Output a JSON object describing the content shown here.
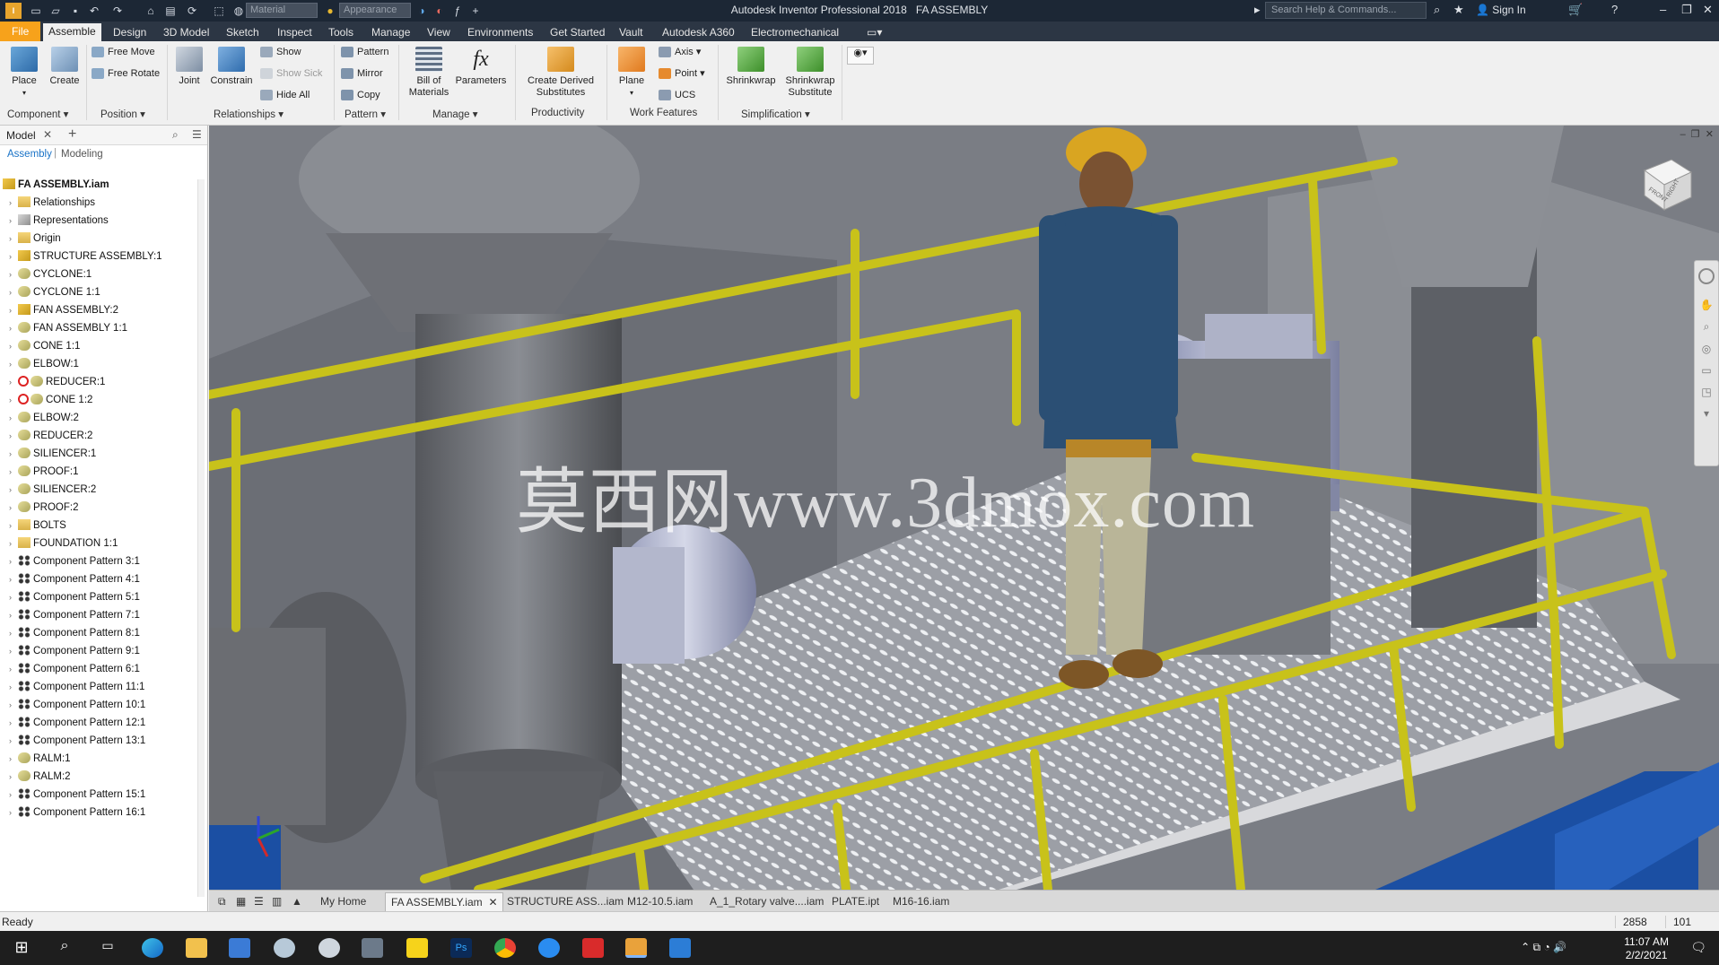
{
  "titlebar": {
    "app_title": "Autodesk Inventor Professional 2018",
    "doc_title": "FA ASSEMBLY",
    "material_dropdown": "Material",
    "appearance_dropdown": "Appearance",
    "search_placeholder": "Search Help & Commands...",
    "sign_in": "Sign In"
  },
  "menu": {
    "file": "File",
    "tabs": [
      "Assemble",
      "Design",
      "3D Model",
      "Sketch",
      "Inspect",
      "Tools",
      "Manage",
      "View",
      "Environments",
      "Get Started",
      "Vault",
      "Autodesk A360",
      "Electromechanical"
    ],
    "active_tab": "Assemble"
  },
  "ribbon": {
    "place": "Place",
    "create": "Create",
    "free_move": "Free Move",
    "free_rotate": "Free Rotate",
    "joint": "Joint",
    "constrain": "Constrain",
    "show": "Show",
    "show_sick": "Show Sick",
    "hide_all": "Hide All",
    "pattern": "Pattern",
    "mirror": "Mirror",
    "copy": "Copy",
    "bill_line1": "Bill of",
    "bill_line2": "Materials",
    "parameters": "Parameters",
    "derived_line1": "Create Derived",
    "derived_line2": "Substitutes",
    "plane": "Plane",
    "axis": "Axis",
    "point": "Point",
    "ucs": "UCS",
    "shrinkwrap": "Shrinkwrap",
    "shrink_sub_line1": "Shrinkwrap",
    "shrink_sub_line2": "Substitute",
    "panels": {
      "component": "Component",
      "position": "Position",
      "relationships": "Relationships",
      "pattern": "Pattern",
      "manage": "Manage",
      "productivity": "Productivity",
      "work_features": "Work Features",
      "simplification": "Simplification"
    }
  },
  "browser": {
    "tab_label": "Model",
    "sub_assembly": "Assembly",
    "sub_modeling": "Modeling",
    "root": "FA ASSEMBLY.iam",
    "nodes": [
      {
        "label": "Relationships",
        "icon": "folder"
      },
      {
        "label": "Representations",
        "icon": "rep"
      },
      {
        "label": "Origin",
        "icon": "folder"
      },
      {
        "label": "STRUCTURE ASSEMBLY:1",
        "icon": "asm"
      },
      {
        "label": "CYCLONE:1",
        "icon": "part"
      },
      {
        "label": "CYCLONE 1:1",
        "icon": "part"
      },
      {
        "label": "FAN ASSEMBLY:2",
        "icon": "asm"
      },
      {
        "label": "FAN ASSEMBLY 1:1",
        "icon": "part"
      },
      {
        "label": "CONE 1:1",
        "icon": "part"
      },
      {
        "label": "ELBOW:1",
        "icon": "part"
      },
      {
        "label": "REDUCER:1",
        "icon": "part",
        "error": true
      },
      {
        "label": "CONE 1:2",
        "icon": "part",
        "error": true
      },
      {
        "label": "ELBOW:2",
        "icon": "part"
      },
      {
        "label": "REDUCER:2",
        "icon": "part"
      },
      {
        "label": "SILIENCER:1",
        "icon": "part"
      },
      {
        "label": "PROOF:1",
        "icon": "part"
      },
      {
        "label": "SILIENCER:2",
        "icon": "part"
      },
      {
        "label": "PROOF:2",
        "icon": "part"
      },
      {
        "label": "BOLTS",
        "icon": "folder"
      },
      {
        "label": "FOUNDATION 1:1",
        "icon": "folder"
      },
      {
        "label": "Component Pattern 3:1",
        "icon": "pattern"
      },
      {
        "label": "Component Pattern 4:1",
        "icon": "pattern"
      },
      {
        "label": "Component Pattern 5:1",
        "icon": "pattern"
      },
      {
        "label": "Component Pattern 7:1",
        "icon": "pattern"
      },
      {
        "label": "Component Pattern 8:1",
        "icon": "pattern"
      },
      {
        "label": "Component Pattern 9:1",
        "icon": "pattern"
      },
      {
        "label": "Component Pattern 6:1",
        "icon": "pattern"
      },
      {
        "label": "Component Pattern 11:1",
        "icon": "pattern"
      },
      {
        "label": "Component Pattern 10:1",
        "icon": "pattern"
      },
      {
        "label": "Component Pattern 12:1",
        "icon": "pattern"
      },
      {
        "label": "Component Pattern 13:1",
        "icon": "pattern"
      },
      {
        "label": "RALM:1",
        "icon": "part"
      },
      {
        "label": "RALM:2",
        "icon": "part"
      },
      {
        "label": "Component Pattern 15:1",
        "icon": "pattern"
      },
      {
        "label": "Component Pattern 16:1",
        "icon": "pattern"
      }
    ]
  },
  "viewport": {
    "watermark": "莫西网www.3dmox.com",
    "viewcube_front": "FRONT",
    "viewcube_right": "RIGHT"
  },
  "doc_tabs": {
    "tabs": [
      "My Home",
      "FA ASSEMBLY.iam",
      "STRUCTURE ASS...iam",
      "M12-10.5.iam",
      "A_1_Rotary valve....iam",
      "PLATE.ipt",
      "M16-16.iam"
    ],
    "active": "FA ASSEMBLY.iam"
  },
  "status": {
    "text": "Ready",
    "count1": "2858",
    "count2": "101"
  },
  "taskbar": {
    "time": "11:07 AM",
    "date": "2/2/2021"
  },
  "colors": {
    "file_tab": "#f7a21b",
    "titlebar": "#1c2735",
    "railing": "#c8c21a",
    "steel_blue": "#1b4fa3",
    "grey_metal": "#6e7076"
  }
}
